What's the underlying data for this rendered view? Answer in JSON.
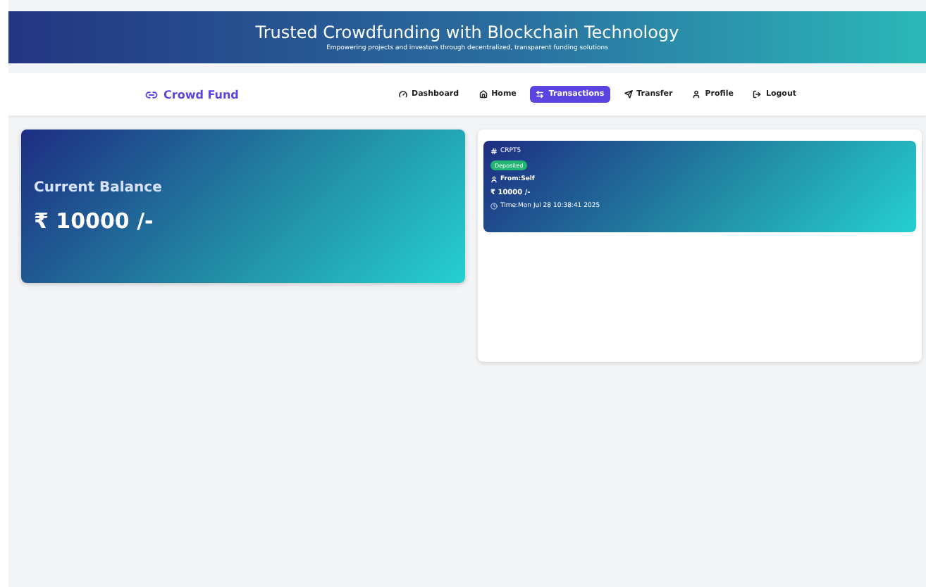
{
  "banner": {
    "title": "Trusted Crowdfunding with Blockchain Technology",
    "subtitle": "Empowering projects and investors through decentralized, transparent funding solutions"
  },
  "navbar": {
    "brand": "Crowd Fund",
    "items": [
      {
        "kind": "dashboard",
        "label": "Dashboard",
        "selected": false
      },
      {
        "kind": "home",
        "label": "Home",
        "selected": false
      },
      {
        "kind": "transactions",
        "label": "Transactions",
        "selected": true
      },
      {
        "kind": "transfer",
        "label": "Transfer",
        "selected": false
      },
      {
        "kind": "profile",
        "label": "Profile",
        "selected": false
      },
      {
        "kind": "logout",
        "label": "Logout",
        "selected": false
      }
    ]
  },
  "balance": {
    "title": "Current Balance",
    "amount": "₹ 10000 /-"
  },
  "transactions": [
    {
      "id": "CRPT5",
      "status": "Deposited",
      "from": "From:Self",
      "amount": "₹ 10000 /-",
      "time": "Time:Mon Jul 28 10:38:41 2025"
    }
  ]
}
